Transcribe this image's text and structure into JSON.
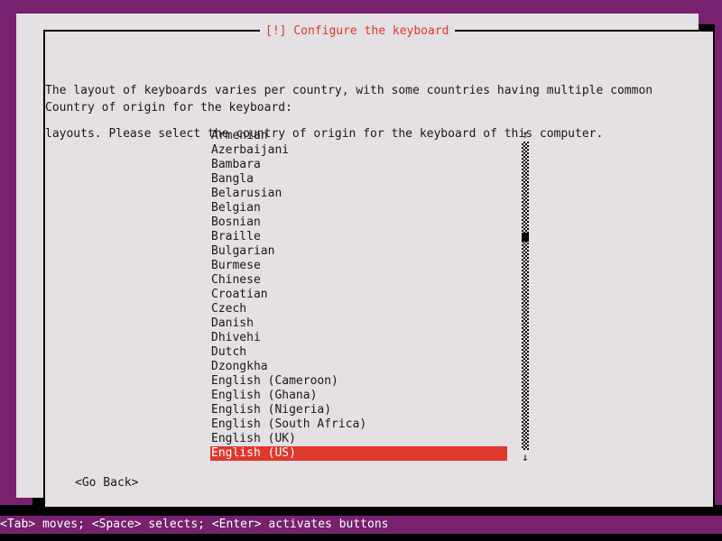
{
  "screen": {
    "background_color": "#77216f",
    "panel_color": "#e4e0e4",
    "accent_color": "#df382c",
    "text_color": "#1a1a1a"
  },
  "dialog": {
    "title": "[!] Configure the keyboard",
    "body_lines": [
      "The layout of keyboards varies per country, with some countries having multiple common",
      "layouts. Please select the country of origin for the keyboard of this computer."
    ],
    "prompt_label": "Country of origin for the keyboard:"
  },
  "list": {
    "items": [
      "Armenian",
      "Azerbaijani",
      "Bambara",
      "Bangla",
      "Belarusian",
      "Belgian",
      "Bosnian",
      "Braille",
      "Bulgarian",
      "Burmese",
      "Chinese",
      "Croatian",
      "Czech",
      "Danish",
      "Dhivehi",
      "Dutch",
      "Dzongkha",
      "English (Cameroon)",
      "English (Ghana)",
      "English (Nigeria)",
      "English (South Africa)",
      "English (UK)",
      "English (US)"
    ],
    "selected_index": 22,
    "selected_value": "English (US)"
  },
  "scrollbar": {
    "up_arrow": "↑",
    "down_arrow": "↓"
  },
  "buttons": {
    "go_back": "<Go Back>"
  },
  "statusbar": {
    "text": "<Tab> moves; <Space> selects; <Enter> activates buttons"
  }
}
